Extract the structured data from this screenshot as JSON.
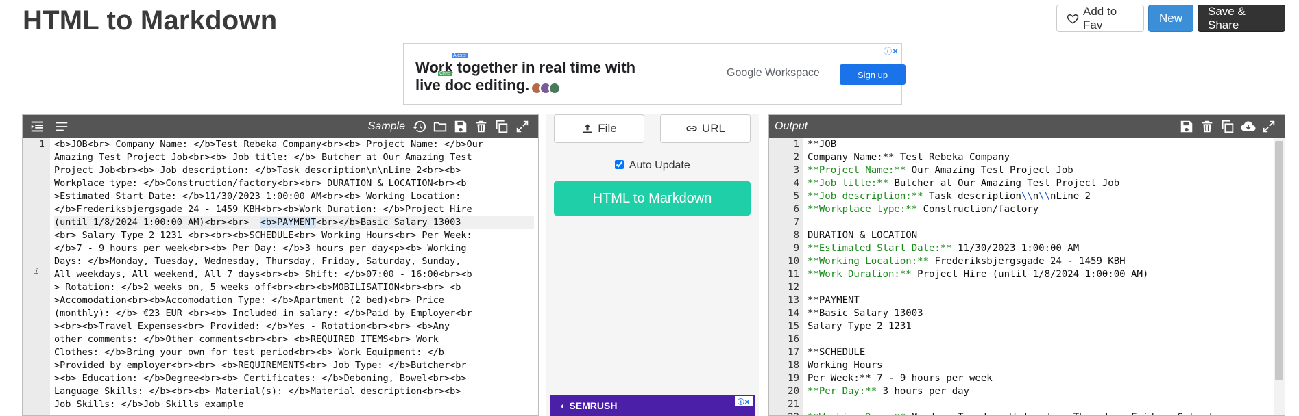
{
  "page": {
    "title": "HTML to Markdown"
  },
  "header": {
    "fav_label": "Add to Fav",
    "new_label": "New",
    "save_label": "Save & Share"
  },
  "ad_top": {
    "line1": "Work together in real time with",
    "line2": "live doc editing.",
    "tag_a": "Alexis",
    "tag_b": "Chris",
    "brand": "Google Workspace",
    "cta": "Sign up"
  },
  "left_panel": {
    "label": "Sample",
    "lines": [
      "<b>JOB<br> Company Name: </b>Test Rebeka Company<br><b> Project Name: </b>Our",
      "Amazing Test Project Job<br><b> Job title: </b> Butcher at Our Amazing Test",
      "Project Job<br><b> Job description: </b>Task description\\n\\nLine 2<br><b>",
      "Workplace type: </b>Construction/factory<br><br> DURATION & LOCATION<br><b",
      ">Estimated Start Date: </b>11/30/2023 1:00:00 AM<br><b> Working Location:",
      "</b>Frederiksbjergsgade 24 - 1459 KBH<br><b>Work Duration: </b>Project Hire",
      "(until 1/8/2024 1:00:00 AM)<br><br>  <b>PAYMENT<br></b>Basic Salary 13003",
      "<br> Salary Type 2 1231 <br><br><b>SCHEDULE<br> Working Hours<br> Per Week:",
      "</b>7 - 9 hours per week<br><b> Per Day: </b>3 hours per day<p><b> Working",
      "Days: </b>Monday, Tuesday, Wednesday, Thursday, Friday, Saturday, Sunday,",
      "All weekdays, All weekend, All 7 days<br><b> Shift: </b>07:00 - 16:00<br><b",
      "> Rotation: </b>2 weeks on, 5 weeks off<br><br><b>MOBILISATION<br><br> <b",
      ">Accomodation<br><b>Accomodation Type: </b>Apartment (2 bed)<br> Price",
      "(monthly): </b> €23 EUR <br><b> Included in salary: </b>Paid by Employer<br",
      "><br><b>Travel Expenses<br> Provided: </b>Yes - Rotation<br><br> <b>Any",
      "other comments: </b>Other comments<br><br> <b>REQUIRED ITEMS<br> Work",
      "Clothes: </b>Bring your own for test period<br><b> Work Equipment: </b",
      ">Provided by employer<br><br> <b>REQUIREMENTS<br> Job Type: </b>Butcher<br",
      "><b> Education: </b>Degree<br><b> Certificates: </b>Deboning, Bowel<br><b>",
      "Language Skills: </b><br><b> Material(s): </b>Material description<br><b>",
      "Job Skills: </b>Job Skills example"
    ]
  },
  "middle": {
    "file_label": "File",
    "url_label": "URL",
    "auto_update_label": "Auto Update",
    "convert_label": "HTML to Markdown",
    "ad_brand": "SEMRUSH"
  },
  "right_panel": {
    "label": "Output",
    "lines": [
      "**JOB",
      "Company Name:** Test Rebeka Company",
      "**Project Name:** Our Amazing Test Project Job",
      "**Job title:** Butcher at Our Amazing Test Project Job",
      "**Job description:** Task description\\\\n\\\\nLine 2",
      "**Workplace type:** Construction/factory",
      "",
      "DURATION & LOCATION",
      "**Estimated Start Date:** 11/30/2023 1:00:00 AM",
      "**Working Location:** Frederiksbjergsgade 24 - 1459 KBH",
      "**Work Duration:** Project Hire (until 1/8/2024 1:00:00 AM)",
      "",
      "**PAYMENT",
      "**Basic Salary 13003",
      "Salary Type 2 1231",
      "",
      "**SCHEDULE",
      "Working Hours",
      "Per Week:** 7 - 9 hours per week",
      "**Per Day:** 3 hours per day",
      "",
      "**Working Days:** Monday, Tuesday, Wednesday, Thursday, Friday, Saturday"
    ]
  }
}
